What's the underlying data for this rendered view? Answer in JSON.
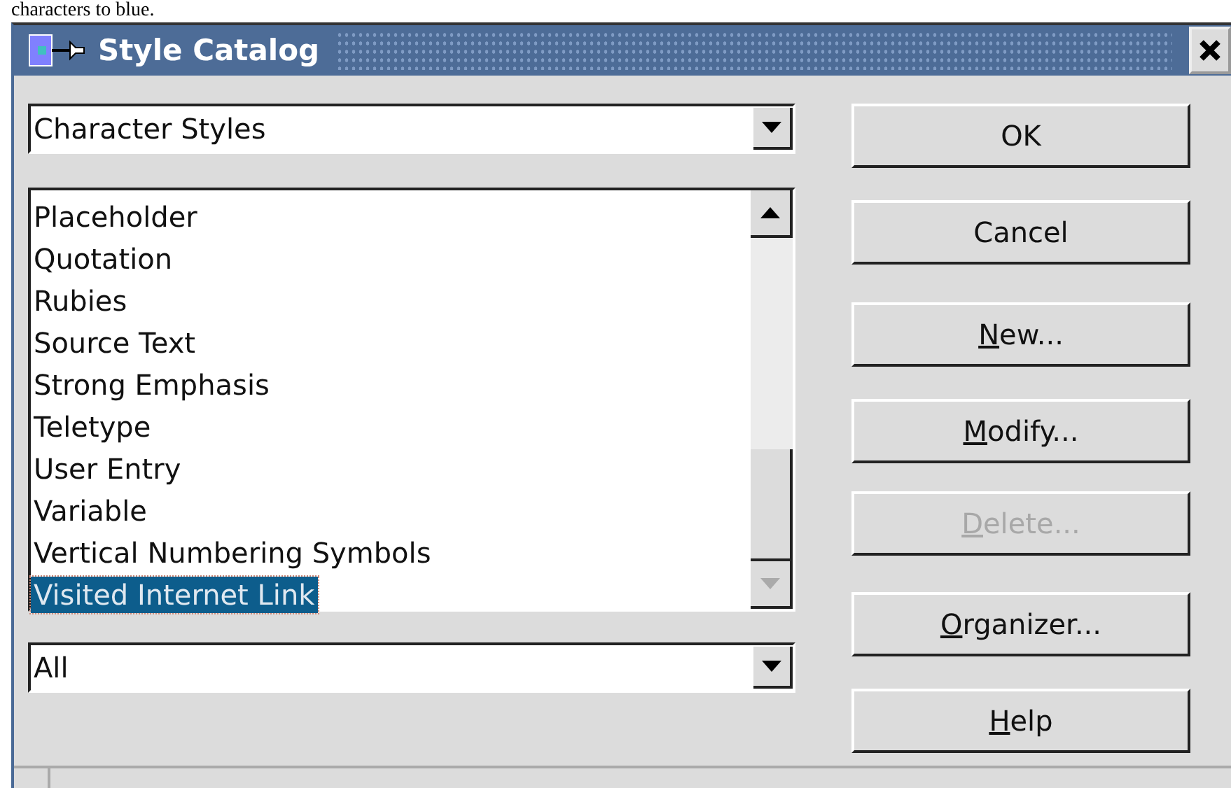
{
  "caption": "characters to blue.",
  "window": {
    "title": "Style Catalog"
  },
  "category_dropdown": {
    "value": "Character Styles"
  },
  "styles_list": [
    {
      "label": "Placeholder",
      "selected": false
    },
    {
      "label": "Quotation",
      "selected": false
    },
    {
      "label": "Rubies",
      "selected": false
    },
    {
      "label": "Source Text",
      "selected": false
    },
    {
      "label": "Strong Emphasis",
      "selected": false
    },
    {
      "label": "Teletype",
      "selected": false
    },
    {
      "label": "User Entry",
      "selected": false
    },
    {
      "label": "Variable",
      "selected": false
    },
    {
      "label": "Vertical Numbering Symbols",
      "selected": false
    },
    {
      "label": "Visited Internet Link",
      "selected": true
    }
  ],
  "filter_dropdown": {
    "value": "All"
  },
  "buttons": [
    {
      "label": "OK",
      "disabled": false
    },
    {
      "label": "Cancel",
      "disabled": false
    },
    {
      "mnemonic": "N",
      "label": "ew...",
      "disabled": false
    },
    {
      "mnemonic": "M",
      "label": "odify...",
      "disabled": false
    },
    {
      "mnemonic": "D",
      "label": "elete...",
      "disabled": true
    },
    {
      "mnemonic": "O",
      "label": "rganizer...",
      "disabled": false
    },
    {
      "mnemonic": "H",
      "label": "elp",
      "disabled": false
    }
  ]
}
